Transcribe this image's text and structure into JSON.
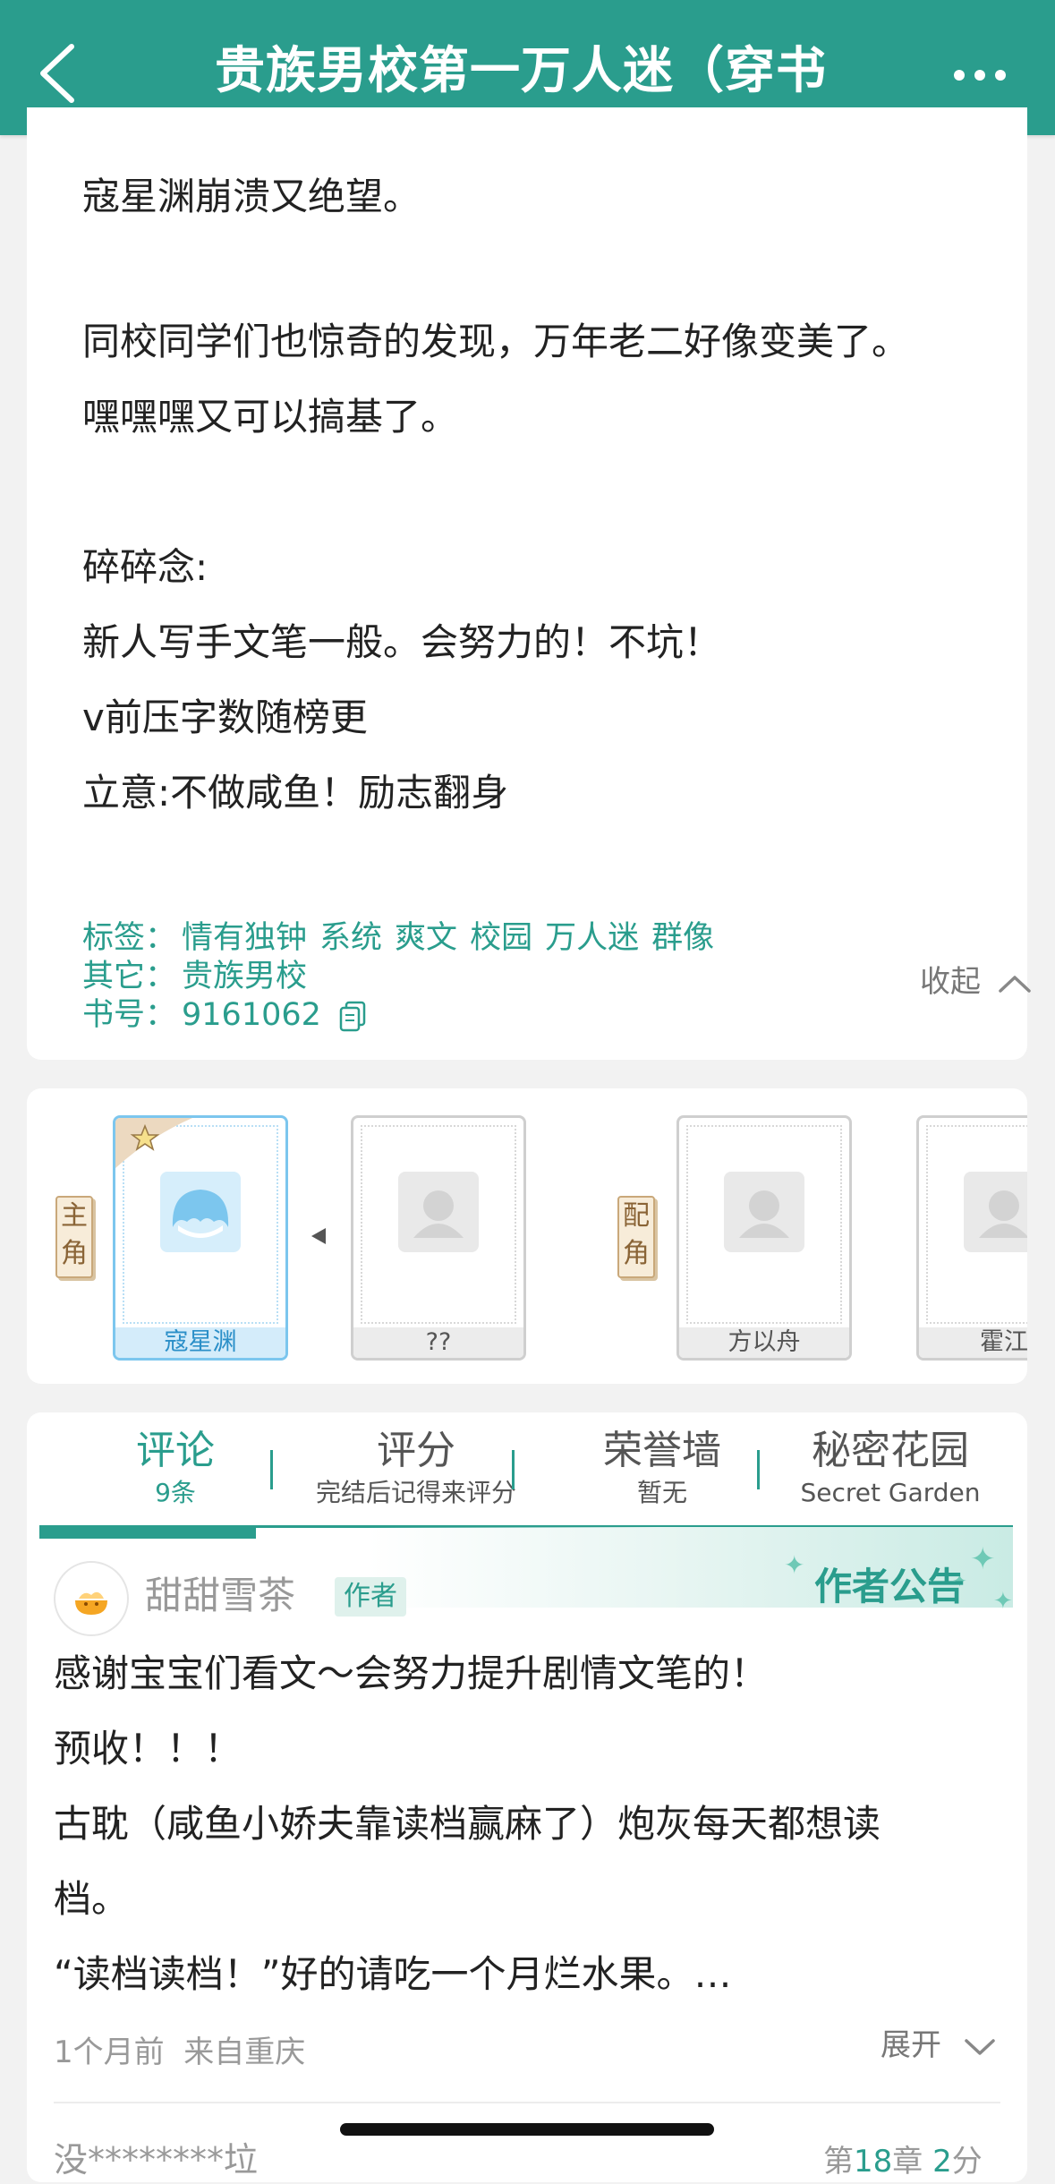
{
  "header": {
    "title": "贵族男校第一万人迷（穿书",
    "bg_color": "#2a9d8d"
  },
  "intro": {
    "lines": [
      "寇星渊崩溃又绝望。",
      "同校同学们也惊奇的发现，万年老二好像变美了。",
      "嘿嘿嘿又可以搞基了。",
      "碎碎念:",
      "新人写手文笔一般。会努力的！不坑！",
      "v前压字数随榜更",
      "立意:不做咸鱼！励志翻身"
    ],
    "collapse_label": "收起",
    "tags_label": "标签：",
    "tags": [
      "情有独钟",
      "系统",
      "爽文",
      "校园",
      "万人迷",
      "群像"
    ],
    "other_label": "其它：",
    "other_value": "贵族男校",
    "book_no_label": "书号：",
    "book_no": "9161062"
  },
  "characters": {
    "main_label": "主角",
    "support_label": "配角",
    "items": [
      {
        "name": "寇星渊",
        "role": "main",
        "active": true
      },
      {
        "name": "??",
        "role": "main",
        "active": false
      },
      {
        "name": "方以舟",
        "role": "support",
        "active": false
      },
      {
        "name": "霍江",
        "role": "support",
        "active": false
      }
    ]
  },
  "tabs": [
    {
      "title": "评论",
      "sub": "9条",
      "active": true
    },
    {
      "title": "评分",
      "sub": "完结后记得来评分",
      "active": false
    },
    {
      "title": "荣誉墙",
      "sub": "暂无",
      "active": false
    },
    {
      "title": "秘密花园",
      "sub": "Secret Garden",
      "active": false
    }
  ],
  "author_post": {
    "name": "甜甜雪茶",
    "badge": "作者",
    "notice_label": "作者公告",
    "lines": [
      "感谢宝宝们看文～会努力提升剧情文笔的！",
      "预收！！！",
      "古耽（咸鱼小娇夫靠读档赢麻了）炮灰每天都想读",
      "档。",
      "“读档读档！”好的请吃一个月烂水果。…"
    ],
    "time": "1个月前",
    "location": "来自重庆",
    "expand_label": "展开"
  },
  "next_comment": {
    "user": "没********垃",
    "chapter_prefix": "第",
    "chapter_no": "18",
    "chapter_mid": "章 ",
    "score": "2",
    "score_suffix": "分"
  }
}
